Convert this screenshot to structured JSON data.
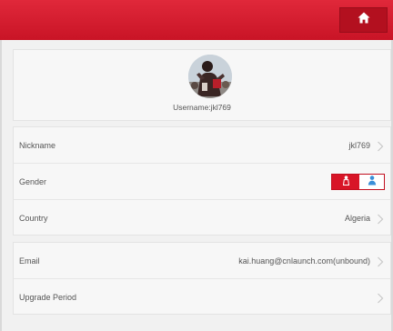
{
  "header": {
    "home_icon": "home-icon",
    "colors": {
      "bar": "#d51a2c",
      "button": "#b3101f"
    }
  },
  "profile": {
    "avatar_icon": "user-avatar-photo",
    "username": "Username:jkl769"
  },
  "rows": {
    "nickname": {
      "label": "Nickname",
      "value": "jkl769"
    },
    "gender": {
      "label": "Gender",
      "options": [
        "female-icon",
        "male-icon"
      ],
      "selected": "female-icon"
    },
    "country": {
      "label": "Country",
      "value": "Algeria"
    },
    "email": {
      "label": "Email",
      "value": "kai.huang@cnlaunch.com(unbound)"
    },
    "upgrade": {
      "label": "Upgrade Period",
      "value": ""
    }
  },
  "colors": {
    "accent": "#d81527",
    "male_icon": "#3a8fd8",
    "text": "#555555",
    "chevron": "#c8c8c8"
  }
}
